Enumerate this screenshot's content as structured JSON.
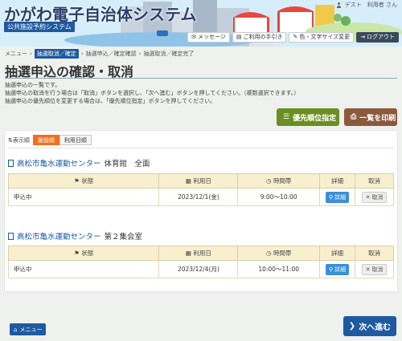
{
  "header": {
    "app_title": "かがわ電子自治体システム",
    "system_name": "公共施設予約システム",
    "user_name": "デスト　利用者 さん",
    "buttons": {
      "message": "メッセージ",
      "help": "ご利用の手引き",
      "display": "色・文字サイズ変更",
      "logout": "ログアウト"
    }
  },
  "breadcrumb": {
    "items": [
      "メニュー",
      "抽選取消／確定",
      "抽選申込／確定確認",
      "抽選取消／確定完了"
    ],
    "separator": "›"
  },
  "page": {
    "title": "抽選申込の確認・取消",
    "description": [
      "抽選申込の一覧です。",
      "抽選申込の取消を行う場合は「取消」ボタンを選択し、「次へ進む」ボタンを押してください。（複数選択できます。）",
      "抽選申込の優先順位を変更する場合は、「優先順位指定」ボタンを押してください。"
    ]
  },
  "actions": {
    "priority": "優先順位指定",
    "print": "一覧を印刷"
  },
  "sort": {
    "label": "表示順",
    "options": [
      "施設順",
      "利用日順"
    ]
  },
  "columns": {
    "status": "状態",
    "date": "利用日",
    "time": "時間帯",
    "detail": "詳細",
    "cancel": "取消"
  },
  "groups": [
    {
      "facility": "高松市亀水運動センター",
      "room": "体育館　全面",
      "rows": [
        {
          "status": "申込中",
          "date": "2023/12/1(金)",
          "time": "9:00〜10:00",
          "detail": "詳細",
          "cancel": "取消"
        }
      ]
    },
    {
      "facility": "高松市亀水運動センター",
      "room": "第２集会室",
      "rows": [
        {
          "status": "申込中",
          "date": "2023/12/4(月)",
          "time": "10:00〜11:00",
          "detail": "詳細",
          "cancel": "取消"
        }
      ]
    }
  ],
  "footer": {
    "menu": "メニュー",
    "next": "次へ進む"
  },
  "colors": {
    "primary": "#1e5aa0",
    "active_sort": "#f07020",
    "priority_btn": "#6b8e23",
    "print_btn": "#8b5a3c",
    "table_header": "#f8efcf"
  }
}
